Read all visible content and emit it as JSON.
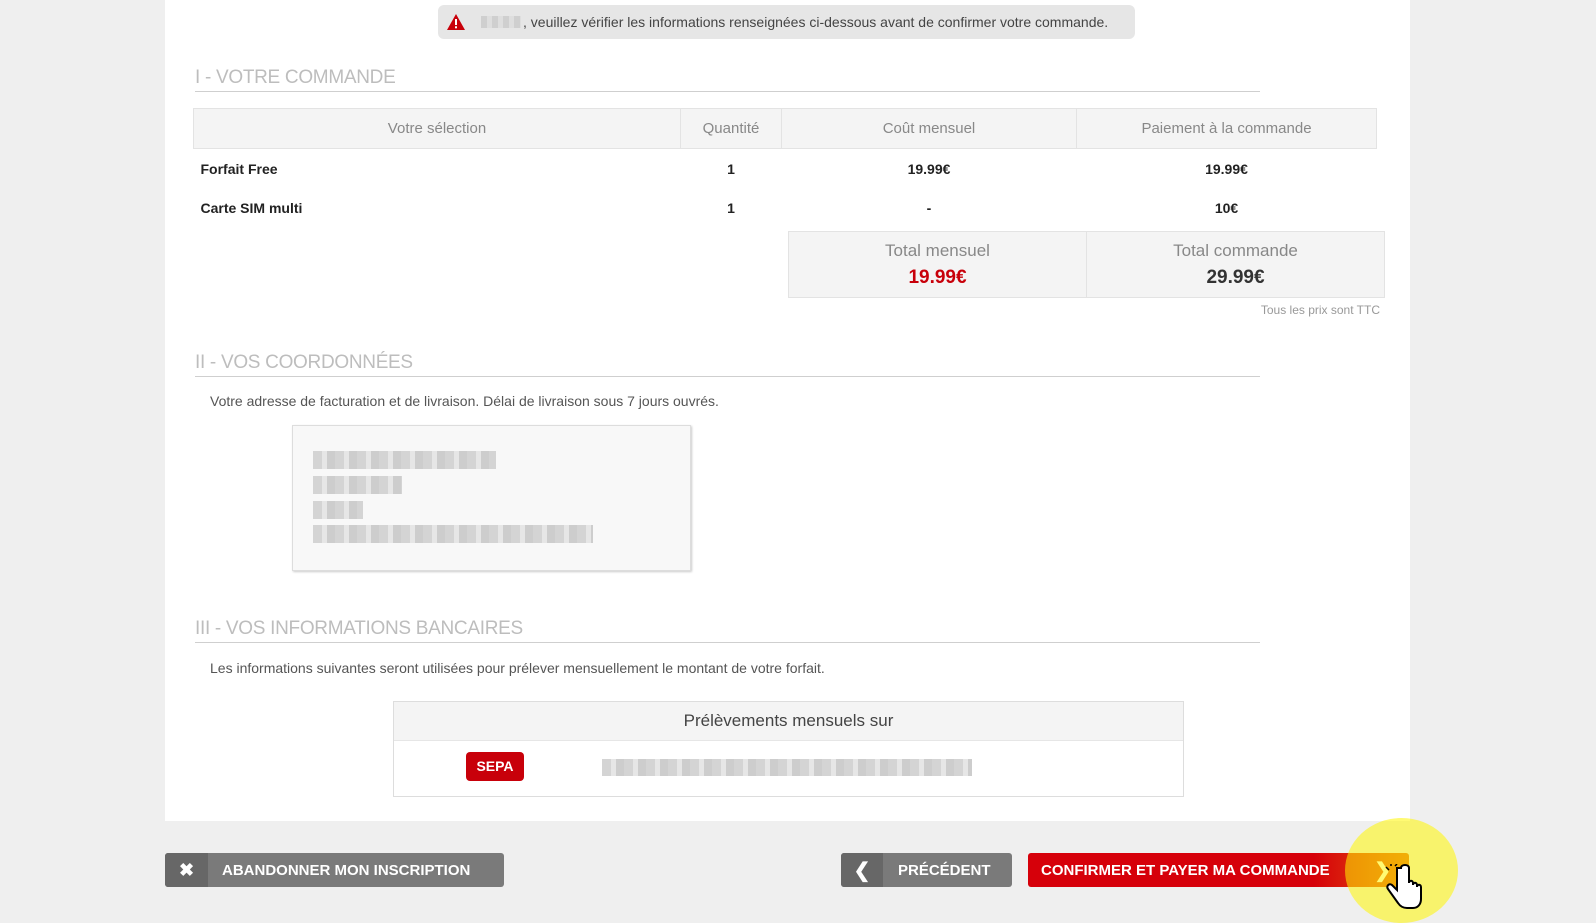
{
  "alert": {
    "text": ", veuillez vérifier les informations renseignées ci-dessous avant de confirmer votre commande."
  },
  "section1": {
    "title": "I - VOTRE COMMANDE",
    "columns": [
      "Votre sélection",
      "Quantité",
      "Coût mensuel",
      "Paiement à la commande"
    ],
    "rows": [
      {
        "name": "Forfait Free",
        "qty": "1",
        "monthly": "19.99€",
        "upfront": "19.99€"
      },
      {
        "name": "Carte SIM multi",
        "qty": "1",
        "monthly": "-",
        "upfront": "10€"
      }
    ],
    "total_monthly_label": "Total mensuel",
    "total_monthly_value": "19.99€",
    "total_order_label": "Total commande",
    "total_order_value": "29.99€",
    "ttc_note": "Tous les prix sont TTC"
  },
  "section2": {
    "title": "II - VOS COORDONNÉES",
    "description": "Votre adresse de facturation et de livraison. Délai de livraison sous 7 jours ouvrés."
  },
  "section3": {
    "title": "III - VOS INFORMATIONS BANCAIRES",
    "description": "Les informations suivantes seront utilisées pour prélever mensuellement le montant de votre forfait.",
    "box_title": "Prélèvements mensuels sur",
    "badge": "SEPA"
  },
  "buttons": {
    "abandon": "ABANDONNER MON INSCRIPTION",
    "previous": "PRÉCÉDENT",
    "confirm": "CONFIRMER ET PAYER MA COMMANDE"
  },
  "colors": {
    "accent_red": "#d6000a",
    "total_red": "#c8000a",
    "grey_button": "#7a7a7a"
  },
  "icons": [
    "warning-icon",
    "close-icon",
    "chevron-left-icon",
    "chevron-right-icon",
    "hand-cursor-icon"
  ]
}
